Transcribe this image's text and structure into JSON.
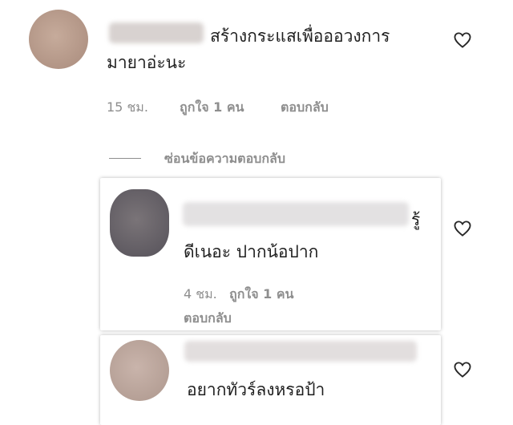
{
  "colors": {
    "text": "#262626",
    "meta": "#8e8e8e",
    "avatar_1": "#b99d8e",
    "avatar_2": "#6e6a70",
    "avatar_3": "#b9a49b"
  },
  "comment": {
    "text_line1": "สร้างกระแสเพื่อออวงการ",
    "text_line2": "มายาอ่ะนะ",
    "time": "15 ชม.",
    "likes": "ถูกใจ 1 คน",
    "reply": "ตอบกลับ"
  },
  "hide_replies": "ซ่อนข้อความตอบกลับ",
  "replies": [
    {
      "name_tail": "รู้",
      "text": "ดีเนอะ ปากน้อปาก",
      "time": "4 ชม.",
      "likes": "ถูกใจ 1 คน",
      "reply": "ตอบกลับ"
    },
    {
      "text": "อยากทัวร์ลงหรอป้า"
    }
  ]
}
